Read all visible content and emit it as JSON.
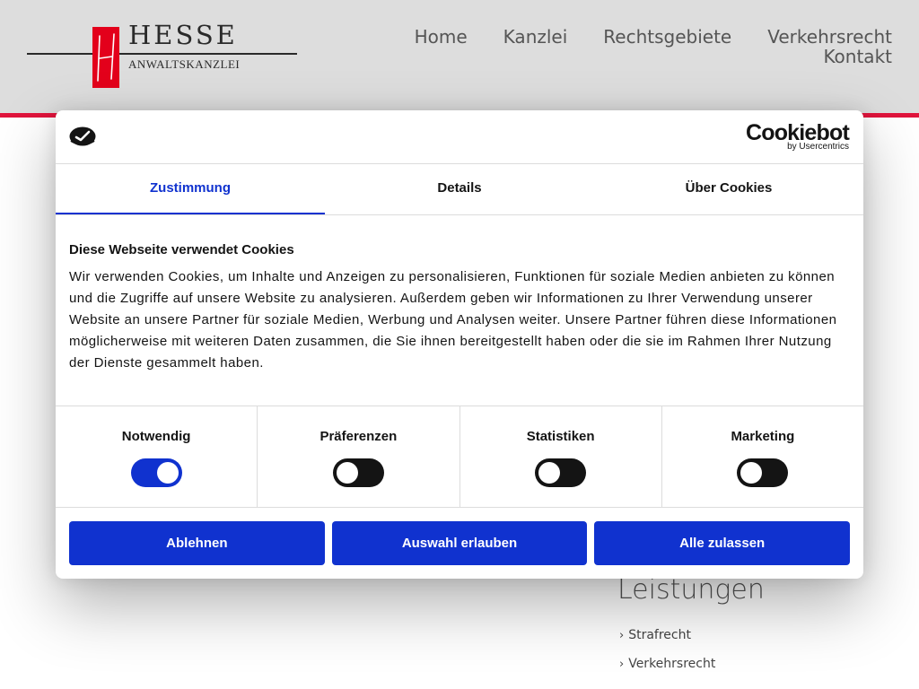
{
  "site": {
    "logo": {
      "name": "HESSE",
      "subtitle": "ANWALTSKANZLEI",
      "mark_letter": "H",
      "mark_color": "#e3001b"
    },
    "nav": [
      {
        "label": "Home"
      },
      {
        "label": "Kanzlei"
      },
      {
        "label": "Rechtsgebiete"
      },
      {
        "label": "Verkehrsrecht"
      },
      {
        "label": "Kontakt"
      }
    ],
    "accent_color": "#e0143c",
    "services": {
      "title": "Leistungen",
      "items": [
        {
          "label": "Strafrecht"
        },
        {
          "label": "Verkehrsrecht"
        }
      ]
    }
  },
  "cookie_dialog": {
    "brand": {
      "name": "Cookiebot",
      "byline": "by Usercentrics",
      "icon": "cookiebot-check-icon"
    },
    "tabs": [
      {
        "label": "Zustimmung",
        "active": true
      },
      {
        "label": "Details",
        "active": false
      },
      {
        "label": "Über Cookies",
        "active": false
      }
    ],
    "heading": "Diese Webseite verwendet Cookies",
    "text": "Wir verwenden Cookies, um Inhalte und Anzeigen zu personalisieren, Funktionen für soziale Medien anbieten zu können und die Zugriffe auf unsere Website zu analysieren. Außerdem geben wir Informationen zu Ihrer Verwendung unserer Website an unsere Partner für soziale Medien, Werbung und Analysen weiter. Unsere Partner führen diese Informationen möglicherweise mit weiteren Daten zusammen, die Sie ihnen bereitgestellt haben oder die sie im Rahmen Ihrer Nutzung der Dienste gesammelt haben.",
    "categories": [
      {
        "label": "Notwendig",
        "enabled": true
      },
      {
        "label": "Präferenzen",
        "enabled": false
      },
      {
        "label": "Statistiken",
        "enabled": false
      },
      {
        "label": "Marketing",
        "enabled": false
      }
    ],
    "buttons": {
      "decline": "Ablehnen",
      "allow_selection": "Auswahl erlauben",
      "allow_all": "Alle zulassen"
    },
    "primary_color": "#1032cf"
  }
}
